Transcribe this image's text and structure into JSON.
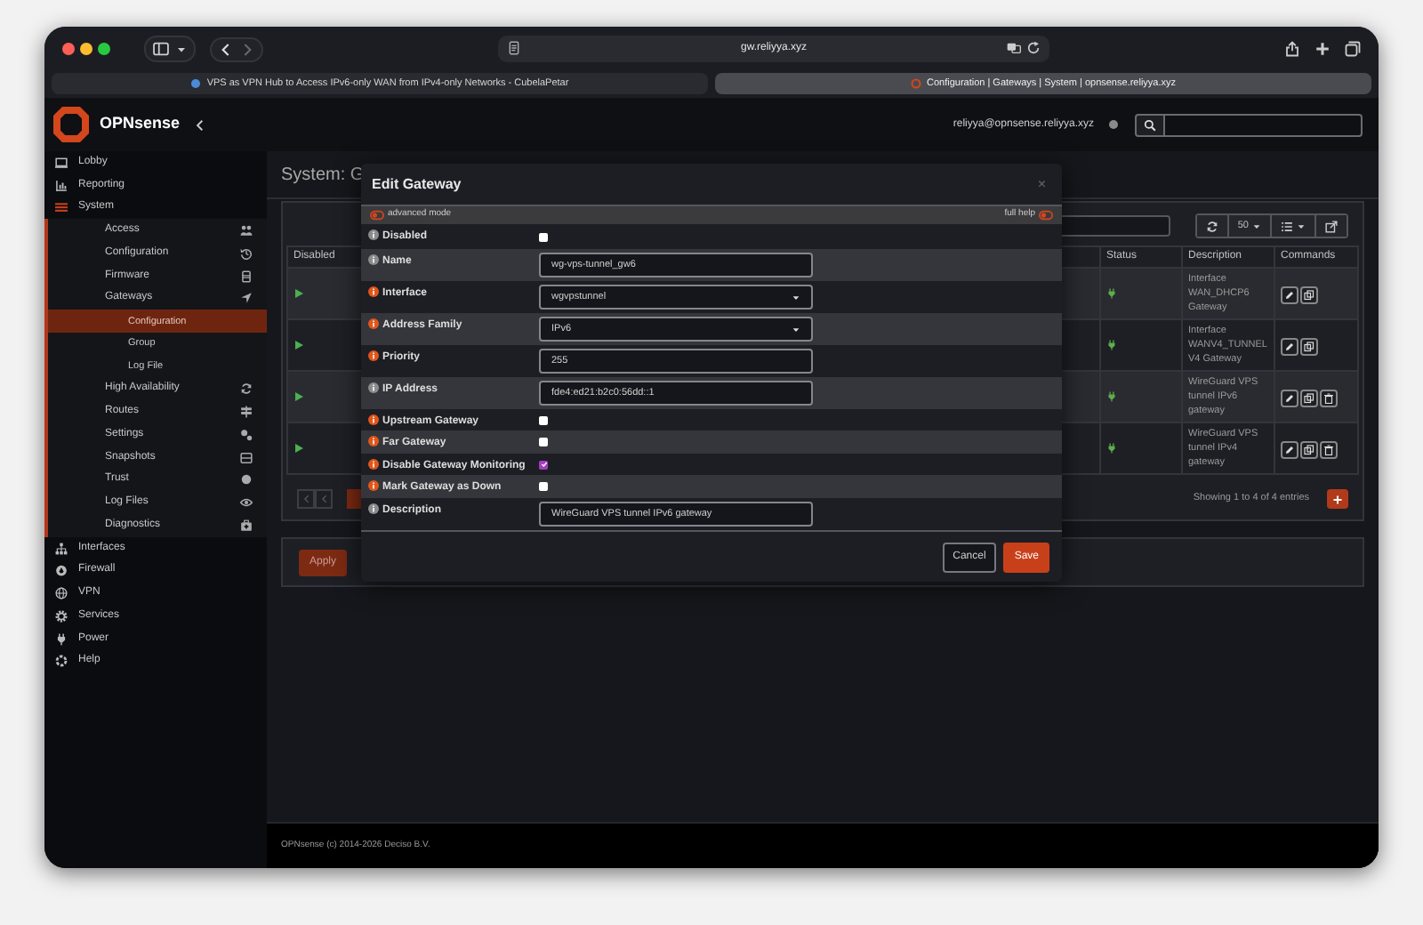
{
  "browser": {
    "url": "gw.reliyya.xyz",
    "tabs": [
      {
        "title": "VPS as VPN Hub to Access IPv6-only WAN from IPv4-only Networks - CubelaPetar",
        "selected": false
      },
      {
        "title": "Configuration | Gateways | System | opnsense.reliyya.xyz",
        "selected": true
      }
    ]
  },
  "header": {
    "brand": "OPNsense",
    "user": "reliyya@opnsense.reliyya.xyz"
  },
  "sidebar": {
    "items": [
      {
        "label": "Lobby",
        "selected": false
      },
      {
        "label": "Reporting",
        "selected": false
      },
      {
        "label": "System",
        "selected": false,
        "expanded": true,
        "children": [
          {
            "label": "Access",
            "selected": false
          },
          {
            "label": "Configuration",
            "selected": false
          },
          {
            "label": "Firmware",
            "selected": false
          },
          {
            "label": "Gateways",
            "selected": false,
            "expanded": true,
            "children": [
              {
                "label": "Configuration",
                "selected": true
              },
              {
                "label": "Group",
                "selected": false
              },
              {
                "label": "Log File",
                "selected": false
              }
            ]
          },
          {
            "label": "High Availability",
            "selected": false
          },
          {
            "label": "Routes",
            "selected": false
          },
          {
            "label": "Settings",
            "selected": false
          },
          {
            "label": "Snapshots",
            "selected": false
          },
          {
            "label": "Trust",
            "selected": false
          },
          {
            "label": "Log Files",
            "selected": false
          },
          {
            "label": "Diagnostics",
            "selected": false
          }
        ]
      },
      {
        "label": "Interfaces",
        "selected": false
      },
      {
        "label": "Firewall",
        "selected": false
      },
      {
        "label": "VPN",
        "selected": false
      },
      {
        "label": "Services",
        "selected": false
      },
      {
        "label": "Power",
        "selected": false
      },
      {
        "label": "Help",
        "selected": false
      }
    ]
  },
  "page": {
    "title": "System: G",
    "page_size": "50",
    "table": {
      "columns": [
        "Disabled",
        "Status",
        "Description",
        "Commands"
      ],
      "rows": [
        {
          "disabled": false,
          "description": "Interface WAN_DHCP6 Gateway",
          "deletable": false
        },
        {
          "disabled": false,
          "description": "Interface WANV4_TUNNELV4 Gateway",
          "deletable": false
        },
        {
          "disabled": false,
          "description": "WireGuard VPS tunnel IPv6 gateway",
          "deletable": true
        },
        {
          "disabled": false,
          "description": "WireGuard VPS tunnel IPv4 gateway",
          "deletable": true
        }
      ]
    },
    "info": "Showing 1 to 4 of 4 entries",
    "apply": "Apply"
  },
  "modal": {
    "title": "Edit Gateway",
    "close": "×",
    "advanced_mode": {
      "label": "advanced mode",
      "on": false
    },
    "full_help": {
      "label": "full help",
      "on": false
    },
    "fields": [
      {
        "label": "Disabled",
        "kind": "checkbox",
        "checked": false,
        "color": "#8c8c8c"
      },
      {
        "label": "Name",
        "kind": "text",
        "value": "wg-vps-tunnel_gw6",
        "color": "#8c8c8c"
      },
      {
        "label": "Interface",
        "kind": "select",
        "value": "wgvpstunnel",
        "color": "#e0561b"
      },
      {
        "label": "Address Family",
        "kind": "select",
        "value": "IPv6",
        "color": "#e0561b"
      },
      {
        "label": "Priority",
        "kind": "text",
        "value": "255",
        "color": "#e0561b"
      },
      {
        "label": "IP Address",
        "kind": "text",
        "value": "fde4:ed21:b2c0:56dd::1",
        "color": "#8c8c8c"
      },
      {
        "label": "Upstream Gateway",
        "kind": "checkbox",
        "checked": false,
        "color": "#e0561b"
      },
      {
        "label": "Far Gateway",
        "kind": "checkbox",
        "checked": false,
        "color": "#e0561b"
      },
      {
        "label": "Disable Gateway Monitoring",
        "kind": "checkbox",
        "checked": true,
        "color": "#e0561b"
      },
      {
        "label": "Mark Gateway as Down",
        "kind": "checkbox",
        "checked": false,
        "color": "#e0561b"
      },
      {
        "label": "Description",
        "kind": "text",
        "value": "WireGuard VPS tunnel IPv6 gateway",
        "color": "#8c8c8c"
      }
    ],
    "buttons": [
      {
        "label": "Cancel",
        "kind": "secondary"
      },
      {
        "label": "Save",
        "kind": "primary"
      }
    ]
  },
  "footer": {
    "brand": "OPNsense",
    "text": "(c) 2014-2026",
    "company": "Deciso B.V."
  }
}
